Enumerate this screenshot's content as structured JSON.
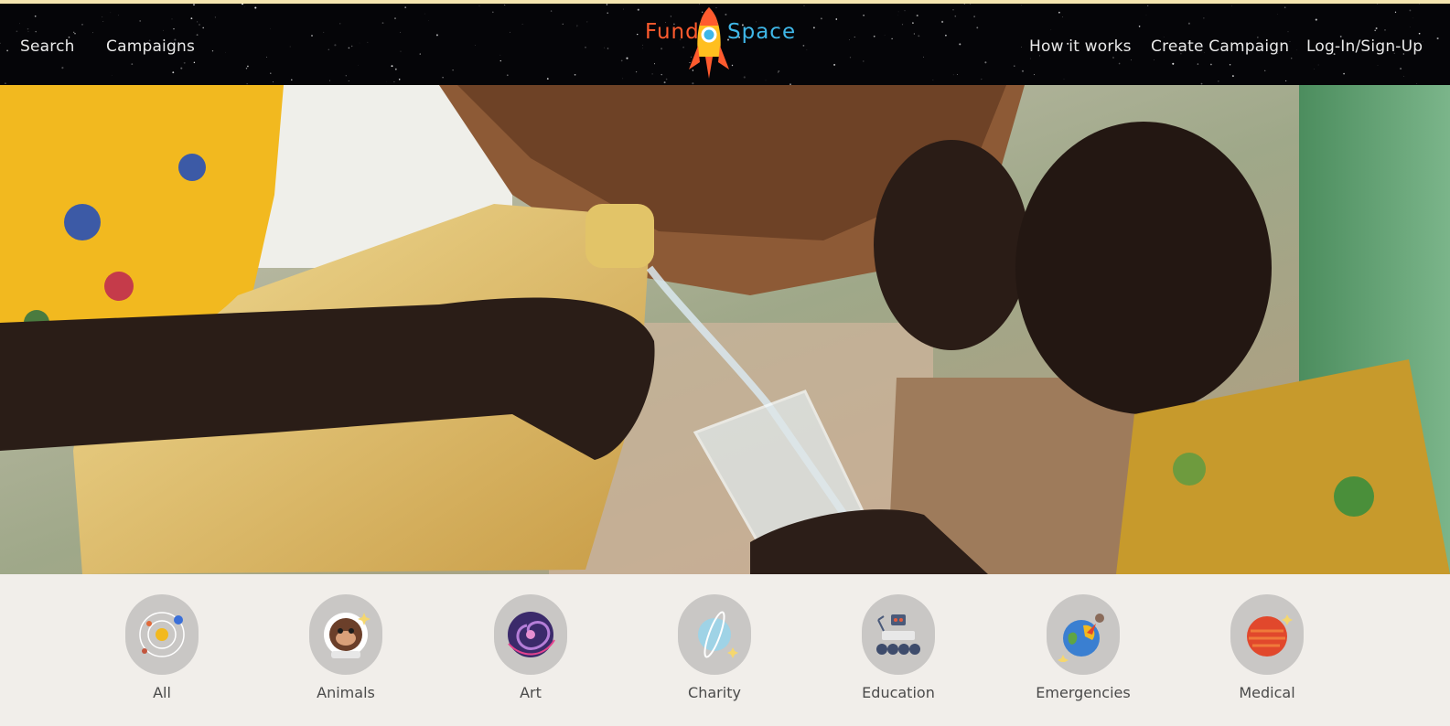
{
  "header": {
    "nav_left": [
      "Search",
      "Campaigns"
    ],
    "nav_right": [
      "How it works",
      "Create Campaign",
      "Log-In/Sign-Up"
    ],
    "logo": {
      "fund": "Fund",
      "space": "Space"
    }
  },
  "categories": [
    {
      "label": "All",
      "icon": "solar-system-icon"
    },
    {
      "label": "Animals",
      "icon": "monkey-astronaut-icon"
    },
    {
      "label": "Art",
      "icon": "galaxy-icon"
    },
    {
      "label": "Charity",
      "icon": "planet-ring-icon"
    },
    {
      "label": "Education",
      "icon": "rover-icon"
    },
    {
      "label": "Emergencies",
      "icon": "asteroid-impact-icon"
    },
    {
      "label": "Medical",
      "icon": "red-planet-icon"
    }
  ],
  "colors": {
    "header_bg": "#050508",
    "logo_fund": "#ff5b2e",
    "logo_space": "#3fb7e8",
    "category_circle": "#c9c7c5",
    "page_bg": "#f1eeea"
  }
}
